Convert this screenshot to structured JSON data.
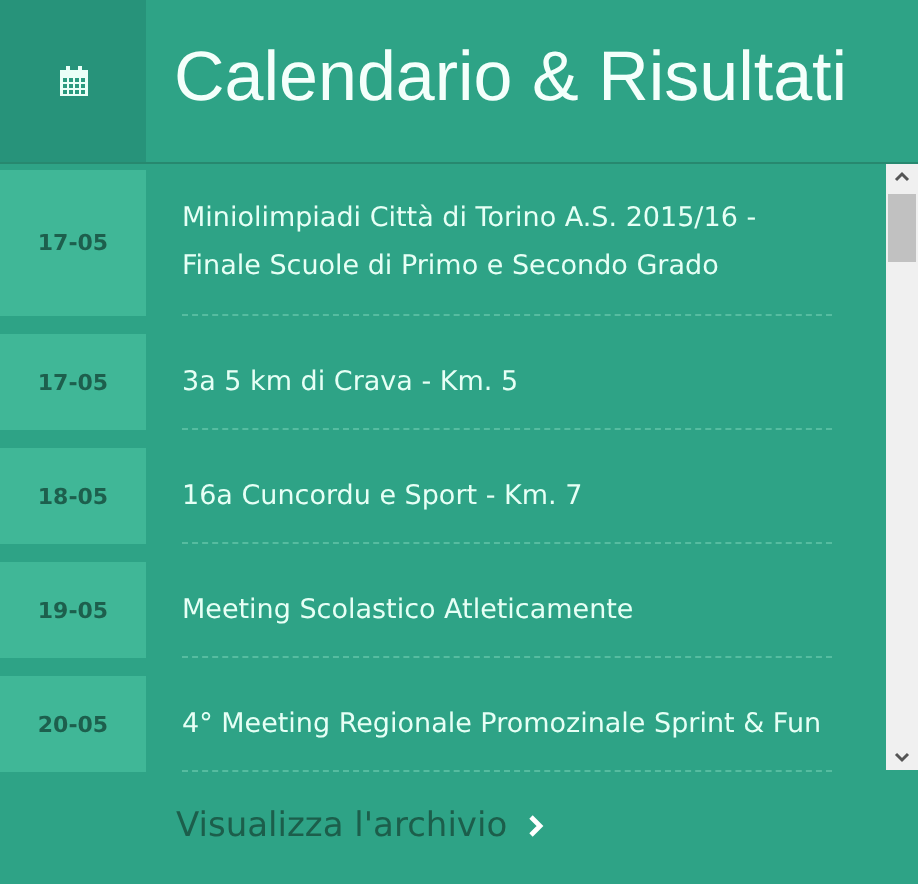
{
  "header": {
    "title": "Calendario & Risultati"
  },
  "events": [
    {
      "date": "17-05",
      "title": "Miniolimpiadi Città di Torino A.S. 2015/16 - Finale Scuole di Primo e Secondo Grado"
    },
    {
      "date": "17-05",
      "title": "3a 5 km di Crava - Km. 5"
    },
    {
      "date": "18-05",
      "title": "16a Cuncordu e Sport - Km. 7"
    },
    {
      "date": "19-05",
      "title": "Meeting Scolastico Atleticamente"
    },
    {
      "date": "20-05",
      "title": "4° Meeting Regionale Promozinale Sprint & Fun"
    }
  ],
  "archive_link": {
    "label": "Visualizza l'archivio"
  }
}
